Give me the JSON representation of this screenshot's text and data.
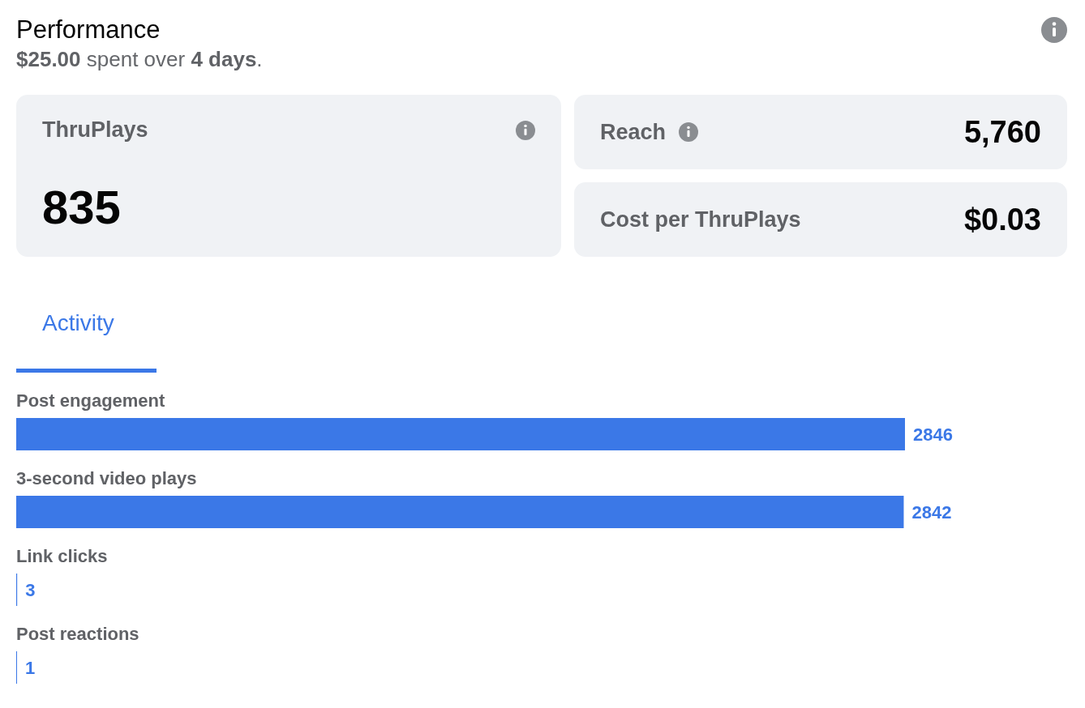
{
  "header": {
    "title": "Performance",
    "summary": "**$25.00** spent over **4 days**."
  },
  "metrics": [
    {
      "label": "ThruPlays",
      "value": "835",
      "info": true
    },
    {
      "label": "Reach",
      "value": "5,760",
      "info": true
    },
    {
      "label": "Cost per ThruPlays",
      "value": "$0.03",
      "info": false
    }
  ],
  "tabs": [
    {
      "label": "Activity",
      "selected": true
    }
  ],
  "activity": {
    "chart_data": {
      "type": "bar",
      "orientation": "horizontal",
      "categories": [
        "Post engagement",
        "3-second video plays",
        "Link clicks",
        "Post reactions"
      ],
      "values": [
        2846,
        2842,
        3,
        1
      ],
      "data_labels": true
    }
  }
}
